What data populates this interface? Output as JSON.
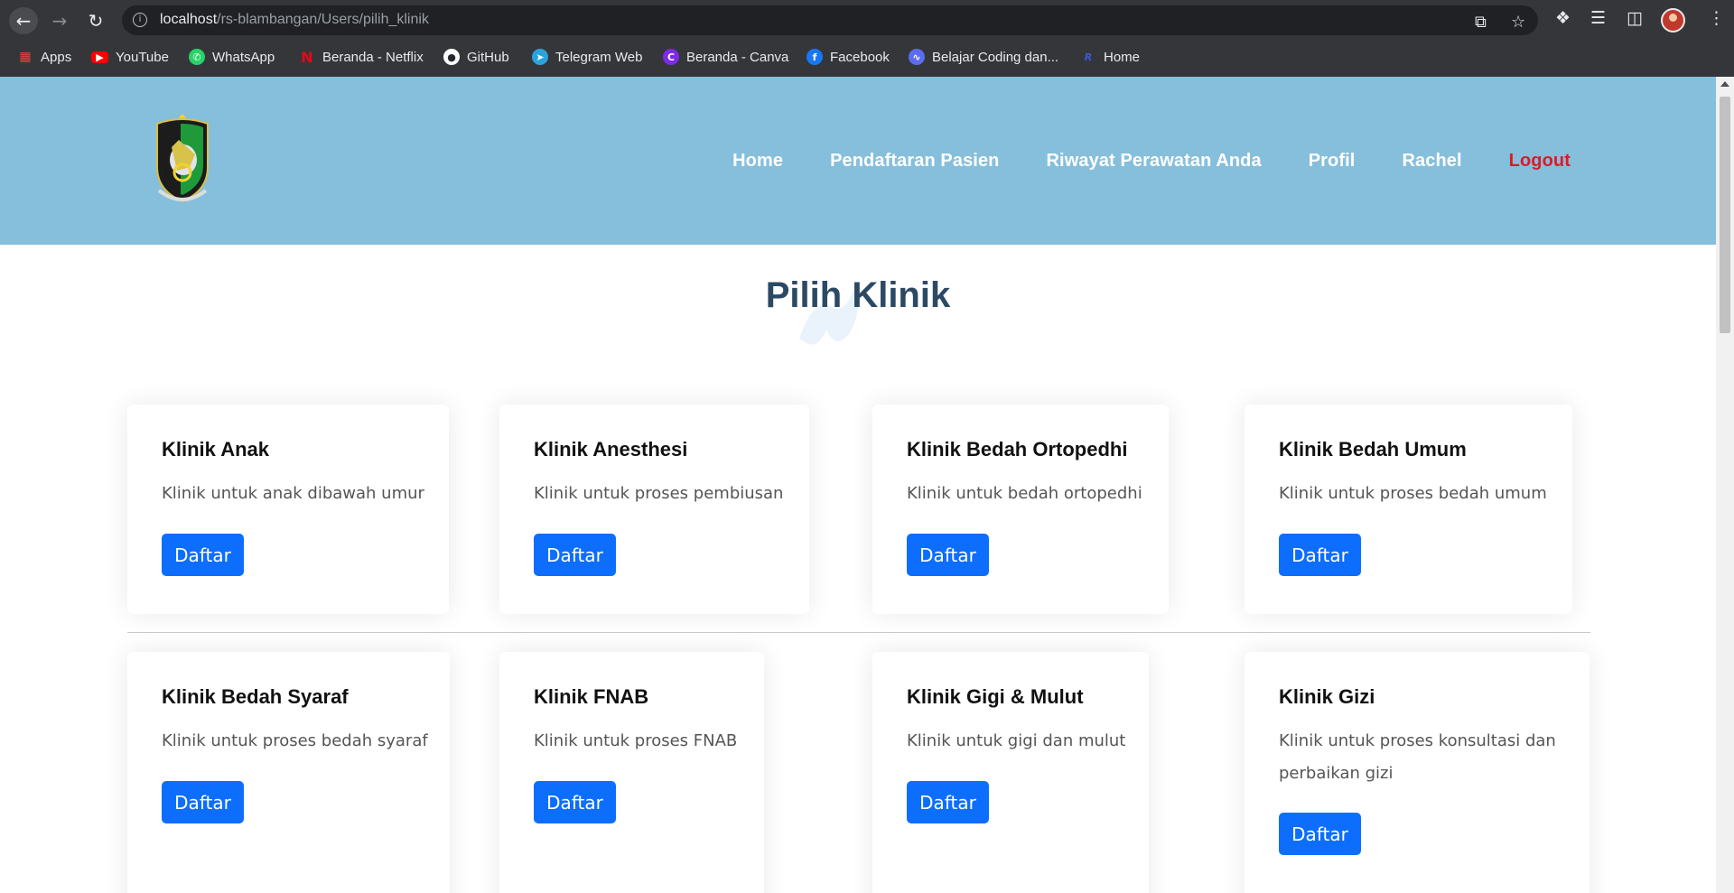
{
  "browser": {
    "url_host": "localhost",
    "url_path": "/rs-blambangan/Users/pilih_klinik",
    "bookmarks": [
      {
        "label": "Apps",
        "icon": "apps-grid-icon",
        "color": "#e8453c"
      },
      {
        "label": "YouTube",
        "icon": "youtube-icon",
        "color": "#ff0000"
      },
      {
        "label": "WhatsApp",
        "icon": "whatsapp-icon",
        "color": "#25d366"
      },
      {
        "label": "Beranda - Netflix",
        "icon": "netflix-icon",
        "color": "#e50914"
      },
      {
        "label": "GitHub",
        "icon": "github-icon",
        "color": "#ffffff"
      },
      {
        "label": "Telegram Web",
        "icon": "telegram-icon",
        "color": "#2aa3dd"
      },
      {
        "label": "Beranda - Canva",
        "icon": "canva-icon",
        "color": "#7d2ae8"
      },
      {
        "label": "Facebook",
        "icon": "facebook-icon",
        "color": "#1877f2"
      },
      {
        "label": "Belajar Coding dan...",
        "icon": "dicoding-icon",
        "color": "#5b6cf0"
      },
      {
        "label": "Home",
        "icon": "home-bookmark-icon",
        "color": "#3b5bdb"
      }
    ]
  },
  "header": {
    "nav": {
      "home": "Home",
      "pendaftaran": "Pendaftaran Pasien",
      "riwayat": "Riwayat Perawatan Anda",
      "profil": "Profil",
      "user": "Rachel",
      "logout": "Logout"
    },
    "colors": {
      "background": "#86bfdc",
      "logout": "#dd1a28"
    }
  },
  "main": {
    "title": "Pilih Klinik",
    "button_label": "Daftar",
    "clinics": [
      {
        "name": "Klinik Anak",
        "desc": "Klinik untuk anak dibawah umur"
      },
      {
        "name": "Klinik Anesthesi",
        "desc": "Klinik untuk proses pembiusan"
      },
      {
        "name": "Klinik Bedah Ortopedhi",
        "desc": "Klinik untuk bedah ortopedhi"
      },
      {
        "name": "Klinik Bedah Umum",
        "desc": "Klinik untuk proses bedah umum"
      },
      {
        "name": "Klinik Bedah Syaraf",
        "desc": "Klinik untuk proses bedah syaraf"
      },
      {
        "name": "Klinik FNAB",
        "desc": "Klinik untuk proses FNAB"
      },
      {
        "name": "Klinik Gigi & Mulut",
        "desc": "Klinik untuk gigi dan mulut"
      },
      {
        "name": "Klinik Gizi",
        "desc": "Klinik untuk proses konsultasi dan perbaikan gizi"
      }
    ],
    "colors": {
      "button": "#0d6efd",
      "title": "#2c4964"
    }
  }
}
